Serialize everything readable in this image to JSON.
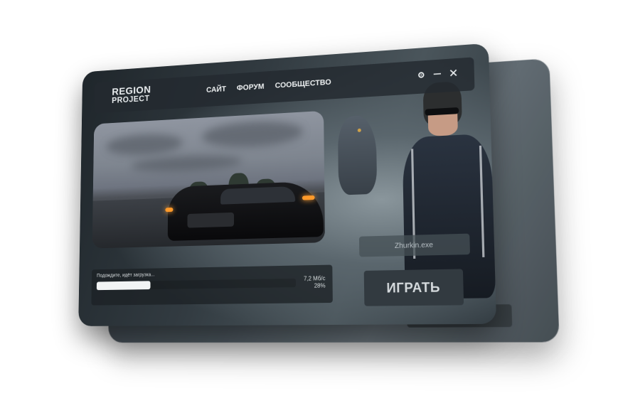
{
  "app": {
    "logo_line1": "REGION",
    "logo_line2": "PROJECT"
  },
  "nav": {
    "items": [
      {
        "label": "САЙТ"
      },
      {
        "label": "ФОРУМ"
      },
      {
        "label": "СООБЩЕСТВО"
      }
    ]
  },
  "window_controls": {
    "settings_icon": "gear-icon",
    "minimize_icon": "minimize-icon",
    "close_icon": "close-icon"
  },
  "user": {
    "name": "Zhurkin.exe"
  },
  "play": {
    "label": "ИГРАТЬ"
  },
  "download": {
    "status": "Подождите, идёт загрузка...",
    "speed": "7,2 Мб/с",
    "percent_label": "28%",
    "progress": 0.28
  },
  "colors": {
    "window_bg": "#323b41",
    "panel_bg": "#232a2f",
    "progress_fill": "#f2f4f5",
    "text": "#eef1f2"
  }
}
